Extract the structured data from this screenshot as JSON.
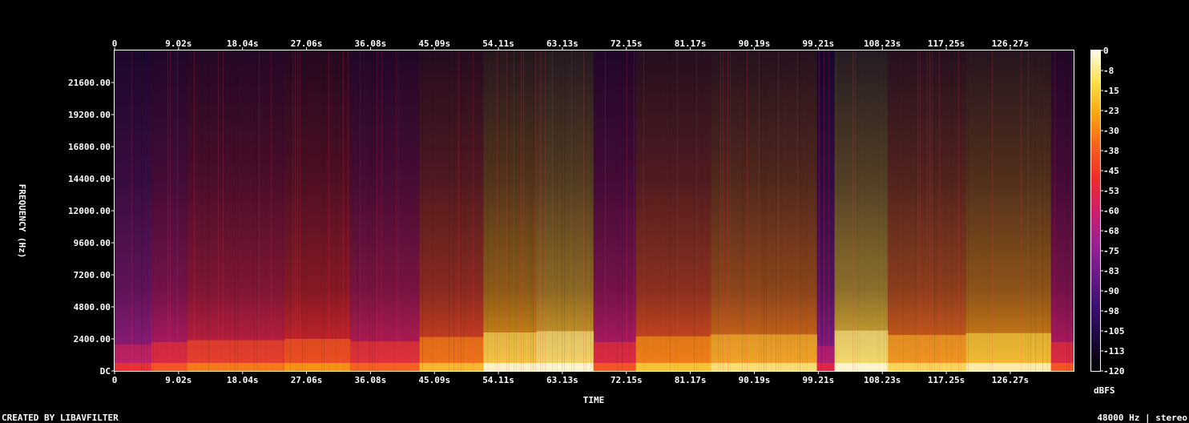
{
  "footer": {
    "created_by": "CREATED BY LIBAVFILTER",
    "format": "48000 Hz | stereo"
  },
  "chart_data": {
    "type": "heatmap",
    "title": "",
    "xlabel": "TIME",
    "ylabel": "FREQUENCY (Hz)",
    "colorbar_label": "dBFS",
    "x_ticks": [
      "0",
      "9.02s",
      "18.04s",
      "27.06s",
      "36.08s",
      "45.09s",
      "54.11s",
      "63.13s",
      "72.15s",
      "81.17s",
      "90.19s",
      "99.21s",
      "108.23s",
      "117.25s",
      "126.27s"
    ],
    "x_tick_seconds": [
      0,
      9.02,
      18.04,
      27.06,
      36.08,
      45.09,
      54.11,
      63.13,
      72.15,
      81.17,
      90.19,
      99.21,
      108.23,
      117.25,
      126.27
    ],
    "x_range": [
      0,
      135.2
    ],
    "y_ticks": [
      "DC",
      "2400.00",
      "4800.00",
      "7200.00",
      "9600.00",
      "12000.00",
      "14400.00",
      "16800.00",
      "19200.00",
      "21600.00"
    ],
    "y_tick_values": [
      0,
      2400,
      4800,
      7200,
      9600,
      12000,
      14400,
      16800,
      19200,
      21600
    ],
    "y_range": [
      0,
      24000
    ],
    "colorbar_ticks": [
      "0",
      "-8",
      "-15",
      "-23",
      "-30",
      "-38",
      "-45",
      "-53",
      "-60",
      "-68",
      "-75",
      "-83",
      "-90",
      "-98",
      "-105",
      "-113",
      "-120"
    ],
    "colorbar_range": [
      -120,
      0
    ],
    "colormap": [
      "#000000",
      "#1a0a3c",
      "#3a0f72",
      "#6a1a8a",
      "#9c2190",
      "#cc1f6a",
      "#ee2b2b",
      "#f7601b",
      "#f9a412",
      "#fbe04a",
      "#fffbe8"
    ],
    "time_segments": [
      {
        "start": 0,
        "end": 5.2,
        "level": 0.42
      },
      {
        "start": 5.2,
        "end": 10.2,
        "level": 0.5
      },
      {
        "start": 10.2,
        "end": 24.0,
        "level": 0.56
      },
      {
        "start": 24.0,
        "end": 33.2,
        "level": 0.6
      },
      {
        "start": 33.2,
        "end": 43.0,
        "level": 0.52
      },
      {
        "start": 43.0,
        "end": 52.0,
        "level": 0.66
      },
      {
        "start": 52.0,
        "end": 59.5,
        "level": 0.8
      },
      {
        "start": 59.5,
        "end": 67.5,
        "level": 0.84
      },
      {
        "start": 67.5,
        "end": 73.5,
        "level": 0.5
      },
      {
        "start": 73.5,
        "end": 84.0,
        "level": 0.68
      },
      {
        "start": 84.0,
        "end": 99.0,
        "level": 0.74
      },
      {
        "start": 99.0,
        "end": 101.5,
        "level": 0.38
      },
      {
        "start": 101.5,
        "end": 109.0,
        "level": 0.86
      },
      {
        "start": 109.0,
        "end": 120.0,
        "level": 0.72
      },
      {
        "start": 120.0,
        "end": 132.0,
        "level": 0.78
      },
      {
        "start": 132.0,
        "end": 135.2,
        "level": 0.5
      }
    ]
  }
}
